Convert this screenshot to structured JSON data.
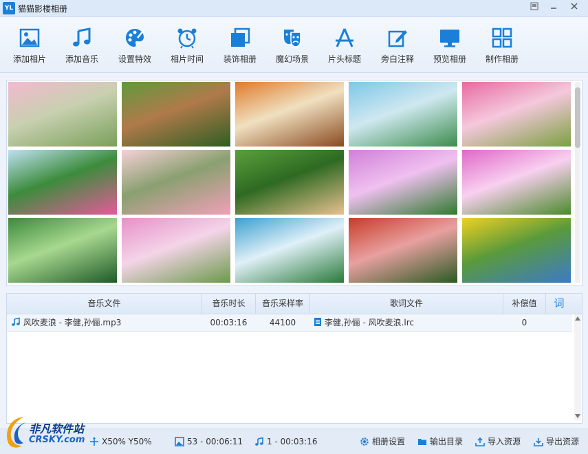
{
  "app": {
    "logo": "YL",
    "title": "猫猫影楼相册"
  },
  "toolbar": [
    {
      "label": "添加相片",
      "icon": "image-icon"
    },
    {
      "label": "添加音乐",
      "icon": "music-note-icon"
    },
    {
      "label": "设置特效",
      "icon": "palette-icon"
    },
    {
      "label": "相片时间",
      "icon": "alarm-clock-icon"
    },
    {
      "label": "装饰相册",
      "icon": "layers-icon"
    },
    {
      "label": "魔幻场景",
      "icon": "theater-mask-icon"
    },
    {
      "label": "片头标题",
      "icon": "title-a-icon"
    },
    {
      "label": "旁白注释",
      "icon": "edit-icon"
    },
    {
      "label": "预览相册",
      "icon": "monitor-icon"
    },
    {
      "label": "制作相册",
      "icon": "grid-icon"
    }
  ],
  "gallery": {
    "photos": [
      {
        "name": "photo-cherry-blossom-path",
        "colors": [
          "#f3b9d0",
          "#7aa05a",
          "#c8d0b0"
        ]
      },
      {
        "name": "photo-forest-boardwalk",
        "colors": [
          "#5f9a3c",
          "#2e5e22",
          "#b07a4a"
        ]
      },
      {
        "name": "photo-autumn-fence",
        "colors": [
          "#e07a2a",
          "#8a4a20",
          "#f0e0c0"
        ]
      },
      {
        "name": "photo-karst-lake",
        "colors": [
          "#7ec7e8",
          "#3c8c4c",
          "#cfe8f0"
        ]
      },
      {
        "name": "photo-pink-peony",
        "colors": [
          "#e76aa0",
          "#7aa040",
          "#f5c8dc"
        ]
      },
      {
        "name": "photo-lotus",
        "colors": [
          "#bfe0f2",
          "#e65a9a",
          "#3c8c3c"
        ]
      },
      {
        "name": "photo-white-roses",
        "colors": [
          "#f6d0d8",
          "#f0a0b8",
          "#8aa070"
        ]
      },
      {
        "name": "photo-kitten-garden",
        "colors": [
          "#5aa03c",
          "#e8c090",
          "#2e6a22"
        ]
      },
      {
        "name": "photo-purple-flowers",
        "colors": [
          "#d080d8",
          "#2e7a2e",
          "#f0c0f0"
        ]
      },
      {
        "name": "photo-pink-wildflowers",
        "colors": [
          "#e068c8",
          "#4a8a2a",
          "#f8d0f0"
        ]
      },
      {
        "name": "photo-green-valley",
        "colors": [
          "#3c8a3c",
          "#1e5a28",
          "#a8d890"
        ]
      },
      {
        "name": "photo-pink-hydrangea",
        "colors": [
          "#e890c8",
          "#6a9a4a",
          "#f4d4e8"
        ]
      },
      {
        "name": "photo-waterfall",
        "colors": [
          "#3ca0d0",
          "#2a7a3a",
          "#e0f0f8"
        ]
      },
      {
        "name": "photo-red-tree-road",
        "colors": [
          "#c83c28",
          "#2a5a22",
          "#e8a0a0"
        ]
      },
      {
        "name": "photo-rapeseed-field",
        "colors": [
          "#f0d020",
          "#3c7ac8",
          "#5a9a3c"
        ]
      }
    ]
  },
  "music": {
    "columns": [
      "音乐文件",
      "音乐时长",
      "音乐采样率",
      "歌词文件",
      "补偿值",
      "词"
    ],
    "rows": [
      {
        "file": "风吹麦浪 - 李健,孙俪.mp3",
        "duration": "00:03:16",
        "sample_rate": "44100",
        "lyrics": "李健,孙俪 - 风吹麦浪.lrc",
        "offset": "0"
      }
    ]
  },
  "status": {
    "position": "X50% Y50%",
    "photos": "53 - 00:06:11",
    "music": "1 - 00:03:16",
    "album_settings": "相册设置",
    "output_dir": "输出目录",
    "import": "导入资源",
    "export": "导出资源"
  },
  "watermark": {
    "cn": "非凡软件站",
    "en": "CRSKY.com"
  },
  "colors": {
    "accent": "#1a7fd8",
    "titlebar": "#dce9f8",
    "toolbar": "#eaf1fa"
  }
}
